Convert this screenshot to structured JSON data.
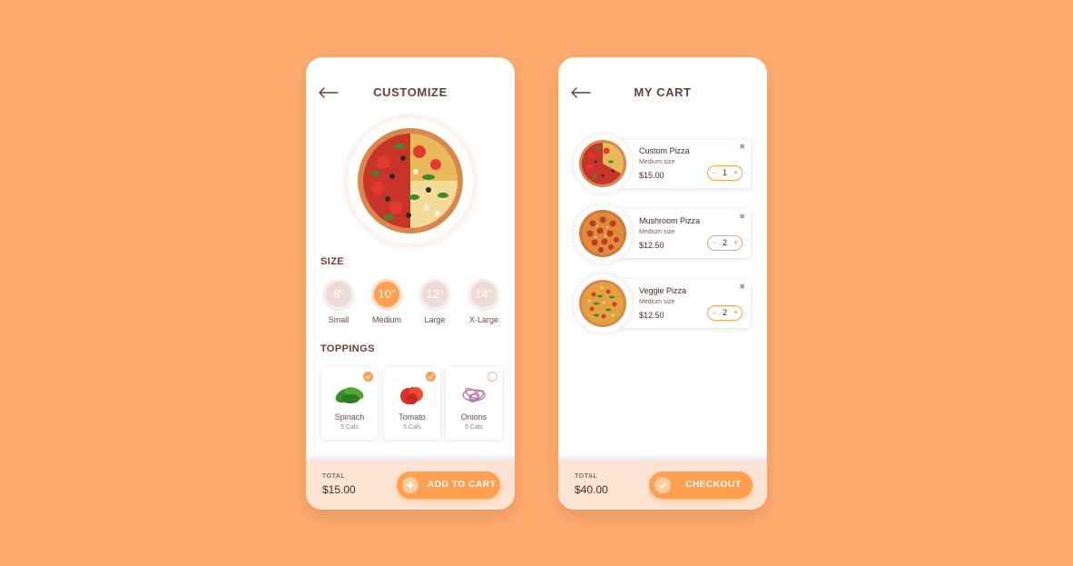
{
  "customize": {
    "title": "CUSTOMIZE",
    "size_label": "SIZE",
    "sizes": [
      {
        "value": "8\"",
        "label": "Small",
        "selected": false
      },
      {
        "value": "10\"",
        "label": "Medium",
        "selected": true
      },
      {
        "value": "12\"",
        "label": "Large",
        "selected": false
      },
      {
        "value": "14\"",
        "label": "X-Large",
        "selected": false
      }
    ],
    "toppings_label": "TOPPINGS",
    "toppings": [
      {
        "name": "Spinach",
        "cals": "5 Cals",
        "selected": true,
        "icon": "spinach-icon"
      },
      {
        "name": "Tomato",
        "cals": "5 Cals",
        "selected": true,
        "icon": "tomato-icon"
      },
      {
        "name": "Onions",
        "cals": "5 Cals",
        "selected": false,
        "icon": "onion-icon"
      }
    ],
    "total_label": "TOTAL",
    "total_value": "$15.00",
    "cta_label": "ADD TO CART"
  },
  "cart": {
    "title": "MY CART",
    "items": [
      {
        "name": "Custom Pizza",
        "size": "Medium size",
        "price": "$15.00",
        "qty": "1"
      },
      {
        "name": "Mushroom Pizza",
        "size": "Medium size",
        "price": "$12.50",
        "qty": "2"
      },
      {
        "name": "Veggie Pizza",
        "size": "Medium size",
        "price": "$12.50",
        "qty": "2"
      }
    ],
    "total_label": "TOTAL",
    "total_value": "$40.00",
    "cta_label": "CHECKOUT"
  },
  "colors": {
    "background": "#FFAB70",
    "accent": "#FF9F4F",
    "footer": "#FDE3D2",
    "title_text": "#6B3F36"
  }
}
